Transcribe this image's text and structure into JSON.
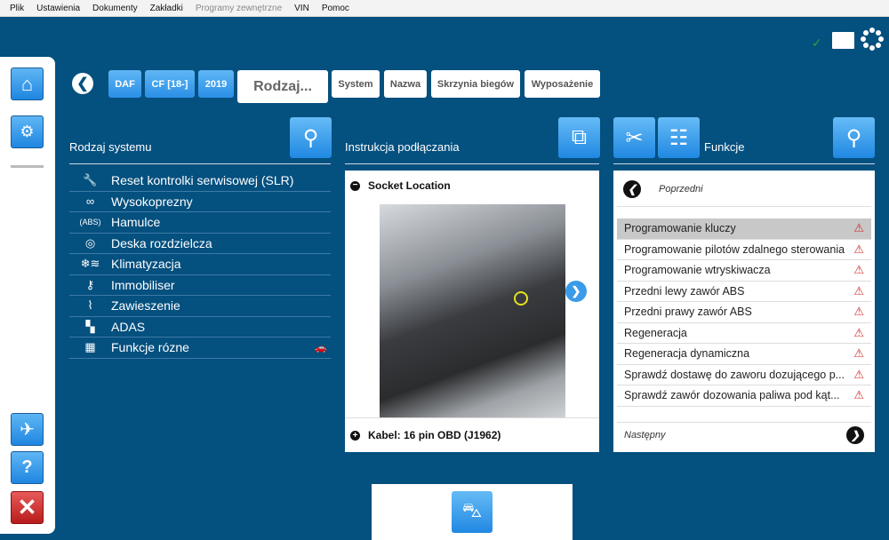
{
  "menu": [
    "Plik",
    "Ustawienia",
    "Dokumenty",
    "Zakładki",
    "Programy zewnętrzne",
    "VIN",
    "Pomoc"
  ],
  "status": {
    "check_icon": "check-icon",
    "battery_icon": "battery-icon",
    "spinner_icon": "loading-icon",
    "check_color": "#2a9d3c"
  },
  "breadcrumbs": {
    "make": "DAF",
    "model": "CF [18-]",
    "year": "2019",
    "current": "Rodzaj...",
    "system": "System",
    "name": "Nazwa",
    "gearbox": "Skrzynia biegów",
    "equipment": "Wyposażenie"
  },
  "left": {
    "title": "Rodzaj systemu",
    "items": [
      {
        "label": "Reset kontrolki serwisowej (SLR)",
        "icon": "wrench-icon"
      },
      {
        "label": "Wysokoprezny",
        "icon": "glow-plug-icon"
      },
      {
        "label": "Hamulce",
        "icon": "abs-icon"
      },
      {
        "label": "Deska rozdzielcza",
        "icon": "dashboard-icon"
      },
      {
        "label": "Klimatyzacja",
        "icon": "climate-icon"
      },
      {
        "label": "Immobiliser",
        "icon": "key-icon"
      },
      {
        "label": "Zawieszenie",
        "icon": "suspension-icon"
      },
      {
        "label": "ADAS",
        "icon": "adas-icon"
      },
      {
        "label": "Funkcje rózne",
        "icon": "misc-icon"
      }
    ]
  },
  "middle": {
    "title": "Instrukcja podłączania",
    "socket": "Socket Location",
    "cable": "Kabel: 16 pin OBD (J1962)"
  },
  "right": {
    "title": "Funkcje",
    "prev": "Poprzedni",
    "next": "Następny",
    "items": [
      "Programowanie kluczy",
      "Programowanie pilotów zdalnego sterowania",
      "Programowanie wtryskiwacza",
      "Przedni lewy zawór ABS",
      "Przedni prawy zawór ABS",
      "Regeneracja",
      "Regeneracja dynamiczna",
      "Sprawdź dostawę do zaworu dozującego p...",
      "Sprawdź zawór dozowania paliwa pod kąt..."
    ],
    "selected": 0
  }
}
